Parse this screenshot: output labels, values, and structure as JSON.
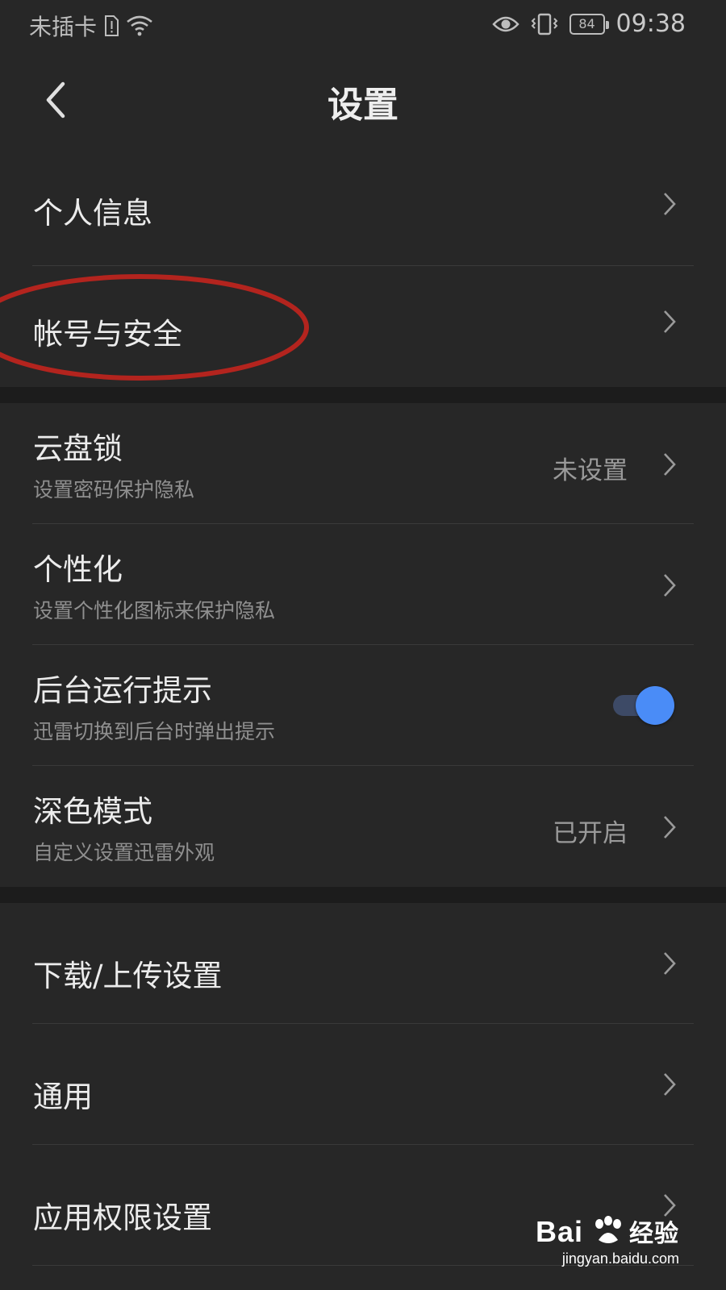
{
  "status": {
    "carrier": "未插卡",
    "battery": "84",
    "time": "09:38"
  },
  "header": {
    "title": "设置"
  },
  "sections": [
    {
      "items": [
        {
          "label": "个人信息"
        },
        {
          "label": "帐号与安全"
        }
      ]
    },
    {
      "items": [
        {
          "label": "云盘锁",
          "sub": "设置密码保护隐私",
          "value": "未设置"
        },
        {
          "label": "个性化",
          "sub": "设置个性化图标来保护隐私"
        },
        {
          "label": "后台运行提示",
          "sub": "迅雷切换到后台时弹出提示",
          "toggle_on": true
        },
        {
          "label": "深色模式",
          "sub": "自定义设置迅雷外观",
          "value": "已开启"
        }
      ]
    },
    {
      "items": [
        {
          "label": "下载/上传设置"
        },
        {
          "label": "通用"
        },
        {
          "label": "应用权限设置"
        }
      ]
    }
  ],
  "watermark": {
    "brand": "Bai",
    "brand_cn": "经验",
    "url": "jingyan.baidu.com"
  },
  "colors": {
    "background": "#272727",
    "band": "#1c1c1c",
    "toggle_accent": "#4a8cf7",
    "annotation": "#b3241e"
  }
}
